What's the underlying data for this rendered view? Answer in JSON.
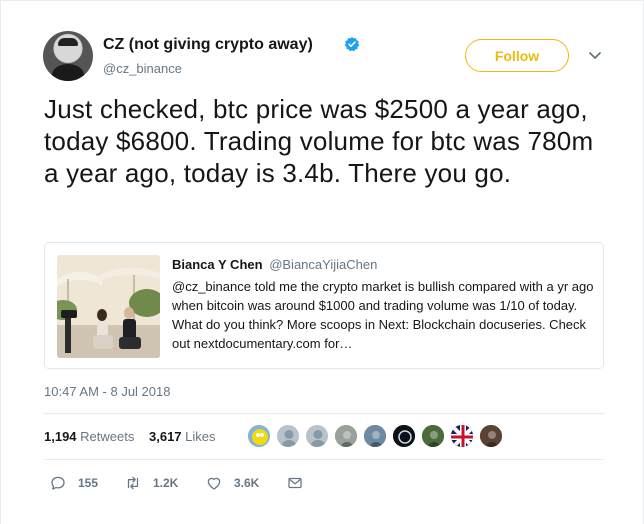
{
  "user": {
    "display_name": "CZ (not giving crypto away)",
    "handle": "@cz_binance",
    "verified": true
  },
  "follow_button": {
    "label": "Follow",
    "color": "#f0b90b"
  },
  "tweet": {
    "text": "Just checked, btc price was $2500 a year ago, today $6800. Trading volume for btc was 780m a year ago, today is 3.4b. There you go."
  },
  "quote": {
    "author_name": "Bianca Y Chen",
    "author_handle": "@BiancaYijiaChen",
    "text": "@cz_binance told me the crypto market is bullish compared with a yr ago when bitcoin was around $1000 and trading volume was 1/10 of today. What do you think? More scoops in Next: Blockchain docuseries. Check out nextdocumentary.com for…"
  },
  "timestamp": "10:47 AM - 8 Jul 2018",
  "stats": {
    "retweets_count": "1,194",
    "retweets_label": "Retweets",
    "likes_count": "3,617",
    "likes_label": "Likes"
  },
  "likers": [
    {
      "icon": "cartoon-avatar",
      "color": "#f5c400"
    },
    {
      "icon": "default-avatar",
      "color": "#b8c2cb"
    },
    {
      "icon": "default-avatar",
      "color": "#b8c2cb"
    },
    {
      "icon": "helicopter-avatar",
      "color": "#9aa09a"
    },
    {
      "icon": "landscape-avatar",
      "color": "#6d8aa3"
    },
    {
      "icon": "space-avatar",
      "color": "#1b1f2a"
    },
    {
      "icon": "person-avatar",
      "color": "#4a6b3a"
    },
    {
      "icon": "flag-avatar",
      "color": "#c8102e"
    },
    {
      "icon": "portrait-avatar",
      "color": "#5a4332"
    }
  ],
  "actions": {
    "reply_count": "155",
    "retweet_count": "1.2K",
    "like_count": "3.6K"
  },
  "colors": {
    "text": "#14171a",
    "secondary_text": "#657786",
    "verified_blue": "#1da1f2",
    "border": "#e6ecf0"
  }
}
